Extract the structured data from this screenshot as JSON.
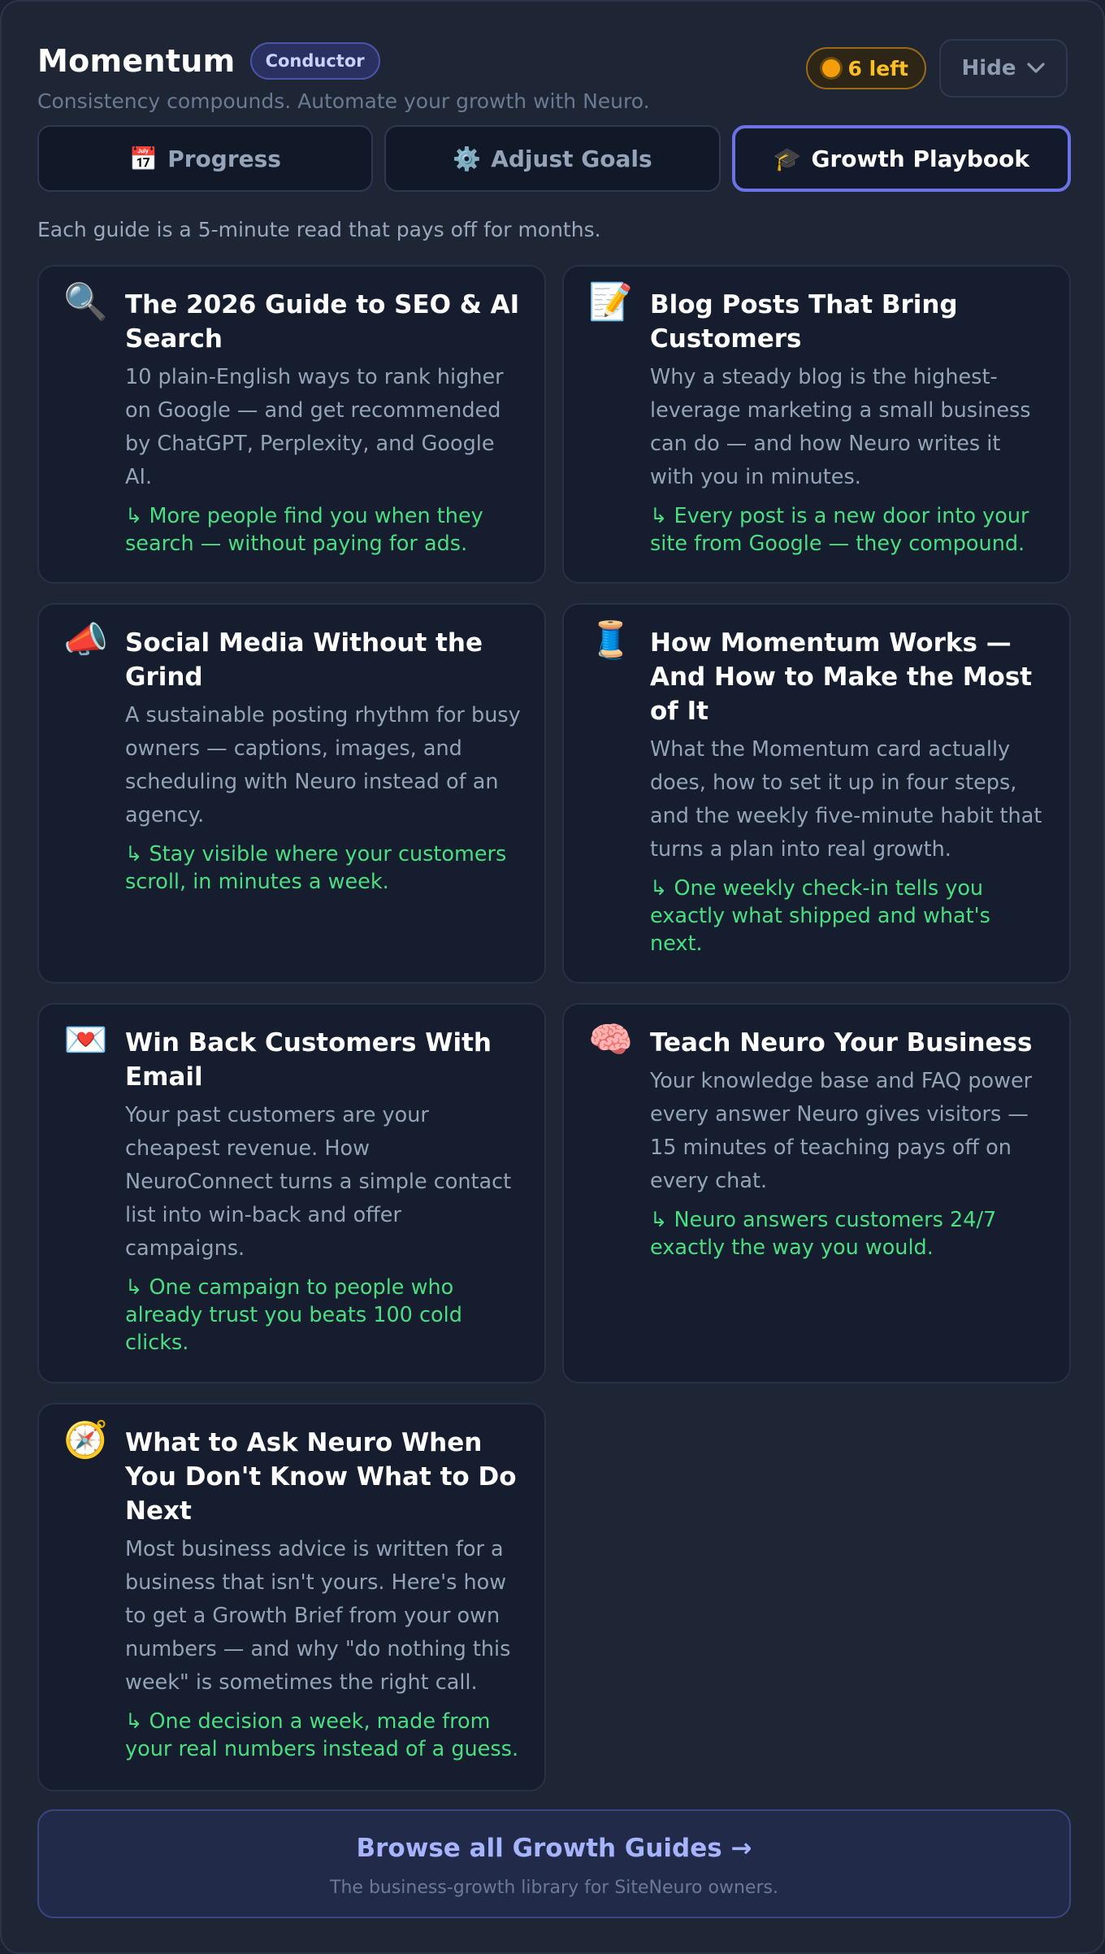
{
  "header": {
    "title": "Momentum",
    "badge": "Conductor",
    "tagline": "Consistency compounds. Automate your growth with Neuro.",
    "credits": "6 left",
    "hide_label": "Hide"
  },
  "tabs": [
    {
      "icon": "📅",
      "label": "Progress"
    },
    {
      "icon": "⚙️",
      "label": "Adjust Goals"
    },
    {
      "icon": "🎓",
      "label": "Growth Playbook"
    }
  ],
  "intro": "Each guide is a 5-minute read that pays off for months.",
  "guides": [
    {
      "icon": "🔍",
      "title": "The 2026 Guide to SEO & AI Search",
      "description": "10 plain-English ways to rank higher on Google — and get recommended by ChatGPT, Perplexity, and Google AI.",
      "benefit": "↳ More people find you when they search — without paying for ads."
    },
    {
      "icon": "📝",
      "title": "Blog Posts That Bring Customers",
      "description": "Why a steady blog is the highest-leverage marketing a small business can do — and how Neuro writes it with you in minutes.",
      "benefit": "↳ Every post is a new door into your site from Google — they compound."
    },
    {
      "icon": "📣",
      "title": "Social Media Without the Grind",
      "description": "A sustainable posting rhythm for busy owners — captions, images, and scheduling with Neuro instead of an agency.",
      "benefit": "↳ Stay visible where your customers scroll, in minutes a week."
    },
    {
      "icon": "🧵",
      "title": "How Momentum Works — And How to Make the Most of It",
      "description": "What the Momentum card actually does, how to set it up in four steps, and the weekly five-minute habit that turns a plan into real growth.",
      "benefit": "↳ One weekly check-in tells you exactly what shipped and what's next."
    },
    {
      "icon": "💌",
      "title": "Win Back Customers With Email",
      "description": "Your past customers are your cheapest revenue. How NeuroConnect turns a simple contact list into win-back and offer campaigns.",
      "benefit": "↳ One campaign to people who already trust you beats 100 cold clicks."
    },
    {
      "icon": "🧠",
      "title": "Teach Neuro Your Business",
      "description": "Your knowledge base and FAQ power every answer Neuro gives visitors — 15 minutes of teaching pays off on every chat.",
      "benefit": "↳ Neuro answers customers 24/7 exactly the way you would."
    },
    {
      "icon": "🧭",
      "title": "What to Ask Neuro When You Don't Know What to Do Next",
      "description": "Most business advice is written for a business that isn't yours. Here's how to get a Growth Brief from your own numbers — and why \"do nothing this week\" is sometimes the right call.",
      "benefit": "↳ One decision a week, made from your real numbers instead of a guess."
    }
  ],
  "browse": {
    "title": "Browse all Growth Guides →",
    "subtitle": "The business-growth library for SiteNeuro owners."
  }
}
